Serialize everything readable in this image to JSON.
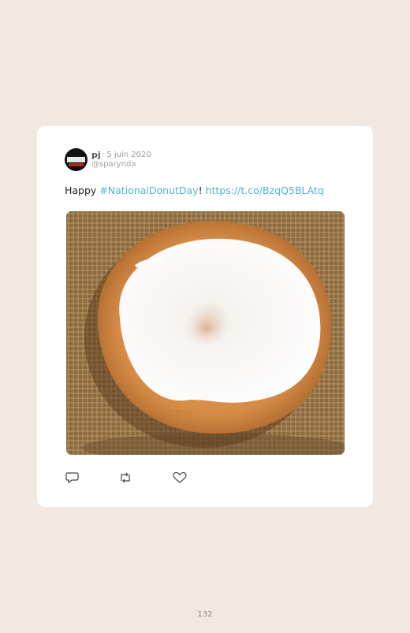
{
  "tweet": {
    "author_name": "pj",
    "date": "· 5 juin 2020",
    "handle": "@sparynda",
    "text_prefix": "Happy ",
    "hashtag": "#NationalDonutDay",
    "text_mid": "! ",
    "link": "https://t.co/BzqQ5BLAtq",
    "image_alt": "glazed donut on a wire rack"
  },
  "actions": {
    "reply_icon": "reply-icon",
    "retweet_icon": "retweet-icon",
    "like_icon": "heart-icon"
  },
  "page_number": "132",
  "colors": {
    "background": "#f3e8df",
    "card": "#ffffff",
    "link": "#4fb3d9"
  }
}
